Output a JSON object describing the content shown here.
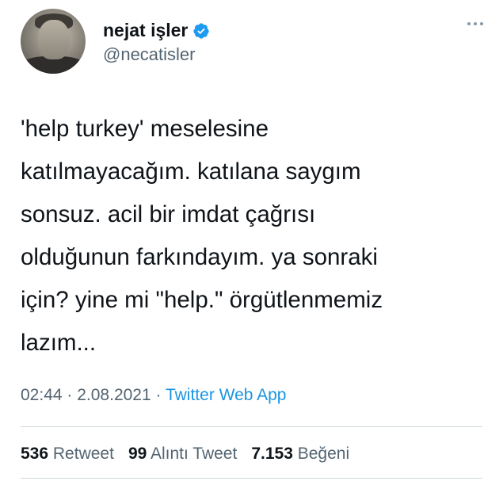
{
  "user": {
    "name": "nejat işler",
    "handle": "@necatisler",
    "verified_color": "#1d9bf0"
  },
  "tweet": {
    "text": "'help turkey' meselesine\nkatılmayacağım. katılana saygım\nsonsuz. acil bir imdat çağrısı\nolduğunun farkındayım. ya sonraki\niçin? yine mi \"help.\" örgütlenmemiz\nlazım..."
  },
  "meta": {
    "time": "02:44",
    "sep1": " · ",
    "date": "2.08.2021",
    "sep2": " · ",
    "app": "Twitter Web App"
  },
  "stats": {
    "retweets_count": "536",
    "retweets_label": "Retweet",
    "quotes_count": "99",
    "quotes_label": "Alıntı Tweet",
    "likes_count": "7.153",
    "likes_label": "Beğeni"
  },
  "icons": {
    "verified": "verified-badge-icon",
    "more": "more-options-icon"
  }
}
